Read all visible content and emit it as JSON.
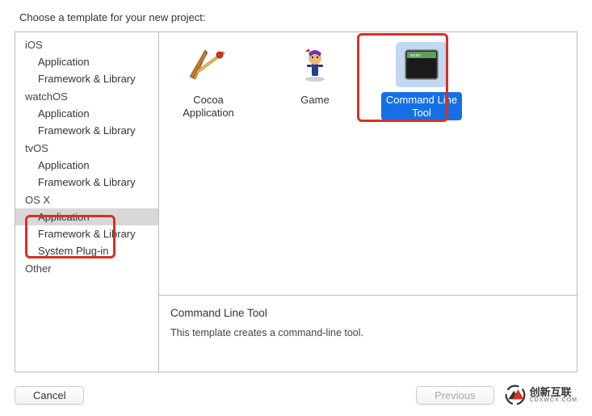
{
  "prompt": "Choose a template for your new project:",
  "sidebar": {
    "groups": [
      {
        "name": "iOS",
        "items": [
          "Application",
          "Framework & Library"
        ]
      },
      {
        "name": "watchOS",
        "items": [
          "Application",
          "Framework & Library"
        ]
      },
      {
        "name": "tvOS",
        "items": [
          "Application",
          "Framework & Library"
        ]
      },
      {
        "name": "OS X",
        "items": [
          "Application",
          "Framework & Library",
          "System Plug-in"
        ]
      },
      {
        "name": "Other",
        "items": []
      }
    ],
    "selected": "OS X / Application"
  },
  "templates": [
    {
      "name": "Cocoa\nApplication"
    },
    {
      "name": "Game"
    },
    {
      "name": "Command Line\nTool"
    }
  ],
  "selected_template": 2,
  "description": {
    "title": "Command Line Tool",
    "text": "This template creates a command-line tool."
  },
  "buttons": {
    "cancel": "Cancel",
    "previous": "Previous"
  },
  "watermark": {
    "text": "创新互联",
    "sub": "CDXWCX.COM"
  }
}
